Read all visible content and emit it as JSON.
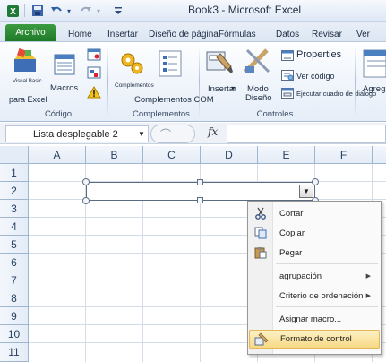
{
  "window": {
    "title": "Book3  -  Microsoft Excel"
  },
  "quick_access": {
    "icons": [
      "excel-logo-icon",
      "save-icon",
      "undo-icon",
      "redo-icon",
      "customize-icon"
    ],
    "redo_arrow": "▾",
    "customize_glyph": "▾"
  },
  "tabs": [
    {
      "label": "Archivo"
    },
    {
      "label": "Home"
    },
    {
      "label": "Insertar"
    },
    {
      "label": "Diseño de página"
    },
    {
      "label": "Fórmulas"
    },
    {
      "label": "Datos"
    },
    {
      "label": "Revisar"
    },
    {
      "label": "Ver"
    }
  ],
  "ribbon": {
    "codigo": {
      "group_label": "Código",
      "visual_basic_small": "Visual Basic",
      "visual_basic_label": "para Excel",
      "macros_label": "Macros"
    },
    "complementos": {
      "group_label": "Complementos",
      "complementos_small": "Complementos",
      "com_label": "Complementos COM"
    },
    "controles": {
      "group_label": "Controles",
      "insertar_label": "Insertar",
      "modo_label_1": "Modo",
      "modo_label_2": "Diseño",
      "properties_label": "Properties",
      "ver_codigo_label": "Ver código",
      "ejecutar_label": "Ejecutar cuadro de diálogo"
    },
    "overflow_label": "Agrega"
  },
  "formula_bar": {
    "name_box": "Lista desplegable 2",
    "name_box_arrow": "▼",
    "ellipsis": "⌒",
    "fx": "fx",
    "formula": ""
  },
  "sheet": {
    "columns": [
      "A",
      "B",
      "C",
      "D",
      "E",
      "F"
    ],
    "rows": [
      "1",
      "2",
      "3",
      "4",
      "5",
      "6",
      "7",
      "8",
      "9",
      "10",
      "11"
    ]
  },
  "dropdown_control": {
    "arrow": "▼"
  },
  "context_menu": {
    "items": [
      {
        "label": "Cortar",
        "icon": "cut-icon"
      },
      {
        "label": "Copiar",
        "icon": "copy-icon"
      },
      {
        "label": "Pegar",
        "icon": "paste-icon"
      },
      {
        "label": "agrupación",
        "submenu": "▶"
      },
      {
        "label": "Criterio de ordenación",
        "submenu": "▶"
      },
      {
        "label": "Asignar macro...",
        "icon": ""
      },
      {
        "label": "Formato de control",
        "icon": "format-control-icon",
        "highlighted": true
      }
    ]
  },
  "colors": {
    "file_tab": "#2a8a33",
    "header_bg": "#e4ecf7",
    "grid_line": "#d4dce7",
    "menu_highlight": "#f7d986"
  }
}
